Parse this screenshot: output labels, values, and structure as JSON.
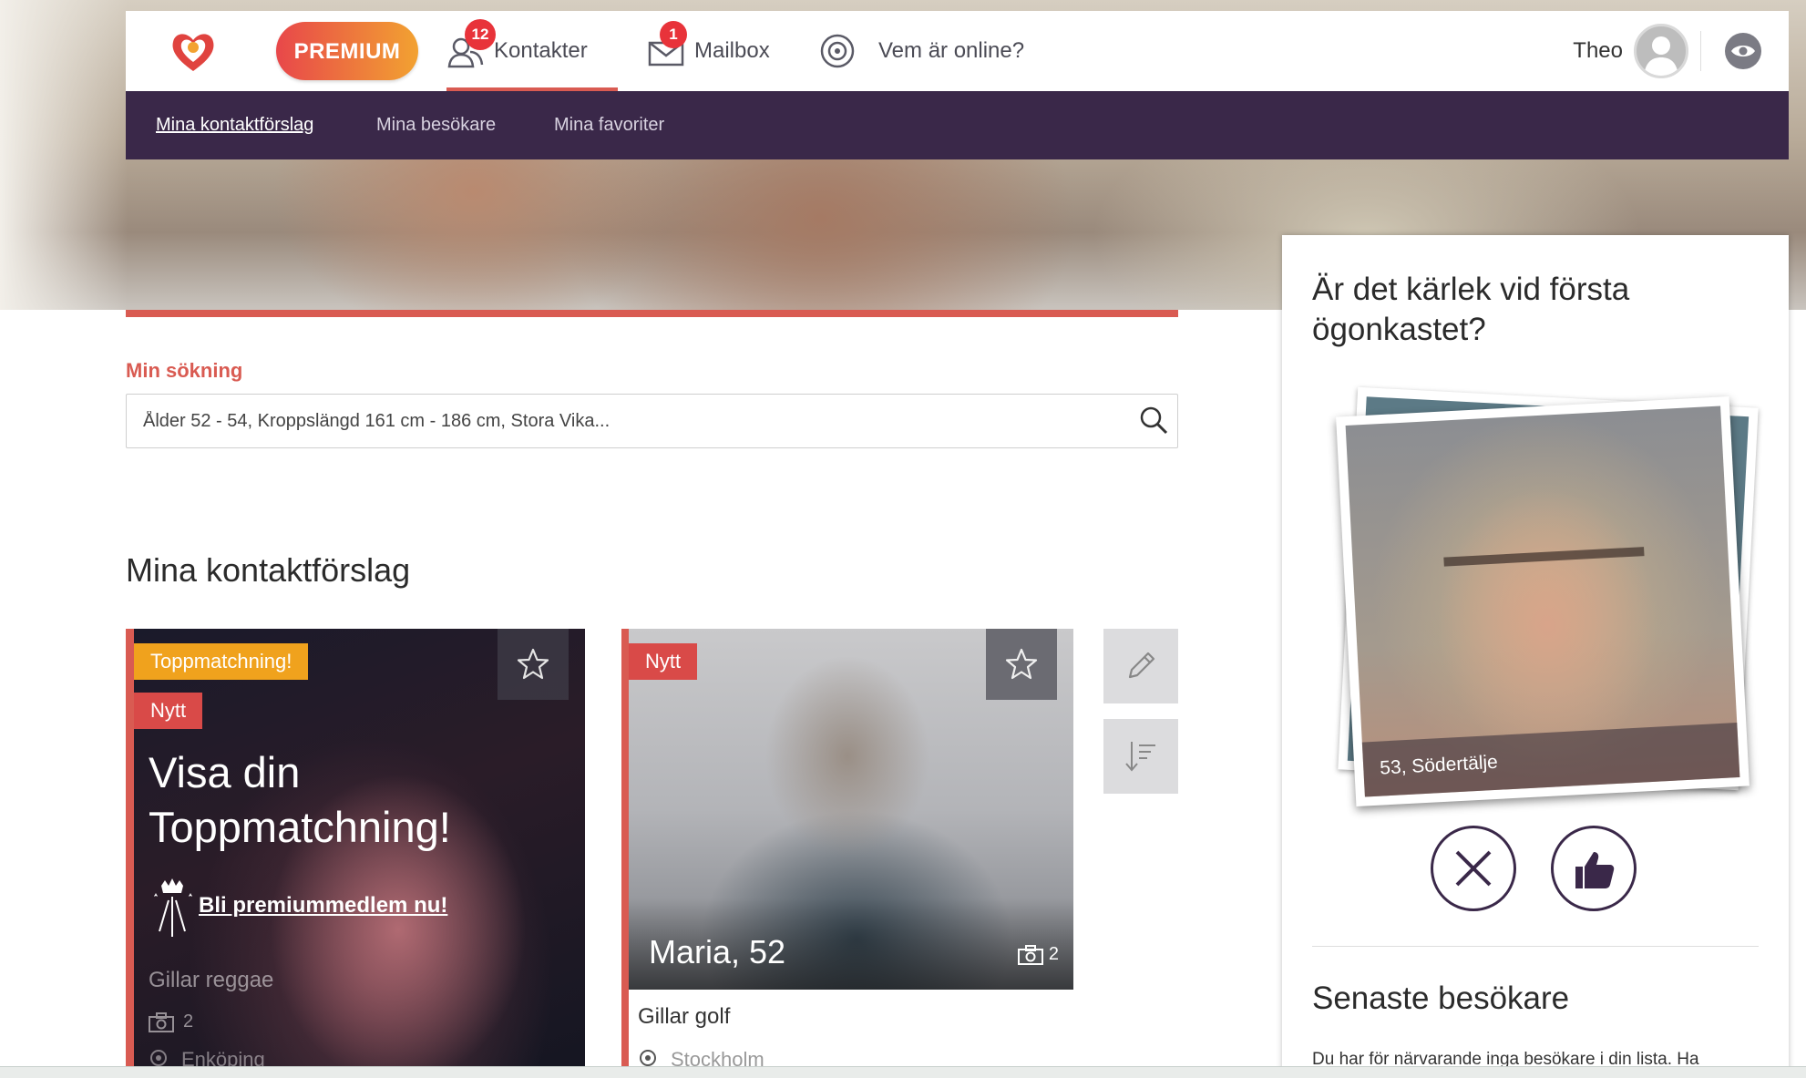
{
  "topbar": {
    "premium_label": "PREMIUM",
    "nav": [
      {
        "label": "Kontakter",
        "badge": "12"
      },
      {
        "label": "Mailbox",
        "badge": "1"
      },
      {
        "label": "Vem är online?"
      }
    ],
    "user_name": "Theo"
  },
  "subnav": [
    "Mina kontaktförslag",
    "Mina besökare",
    "Mina favoriter"
  ],
  "search": {
    "label": "Min sökning",
    "value": "Ålder 52 - 54, Kroppslängd 161 cm - 186 cm, Stora Vika..."
  },
  "section_title": "Mina kontaktförslag",
  "cards": [
    {
      "tags": [
        "Toppmatchning!",
        "Nytt"
      ],
      "headline": "Visa din Toppmatchning!",
      "cta": "Bli premiummedlem nu!",
      "interest": "Gillar reggae",
      "photos": "2",
      "city": "Enköping"
    },
    {
      "tags": [
        "Nytt"
      ],
      "name": "Maria, 52",
      "photos": "2",
      "interest": "Gillar golf",
      "city": "Stockholm"
    }
  ],
  "panel": {
    "title": "Är det kärlek vid första ögonkastet?",
    "photo_caption": "53, Södertälje",
    "visitors_title": "Senaste besökare",
    "visitors_text": "Du har för närvarande inga besökare i din lista. Ha"
  },
  "colors": {
    "accent_red": "#d95b52",
    "subnav_bg": "#3a2849",
    "tag_yellow": "#f0a21d"
  }
}
